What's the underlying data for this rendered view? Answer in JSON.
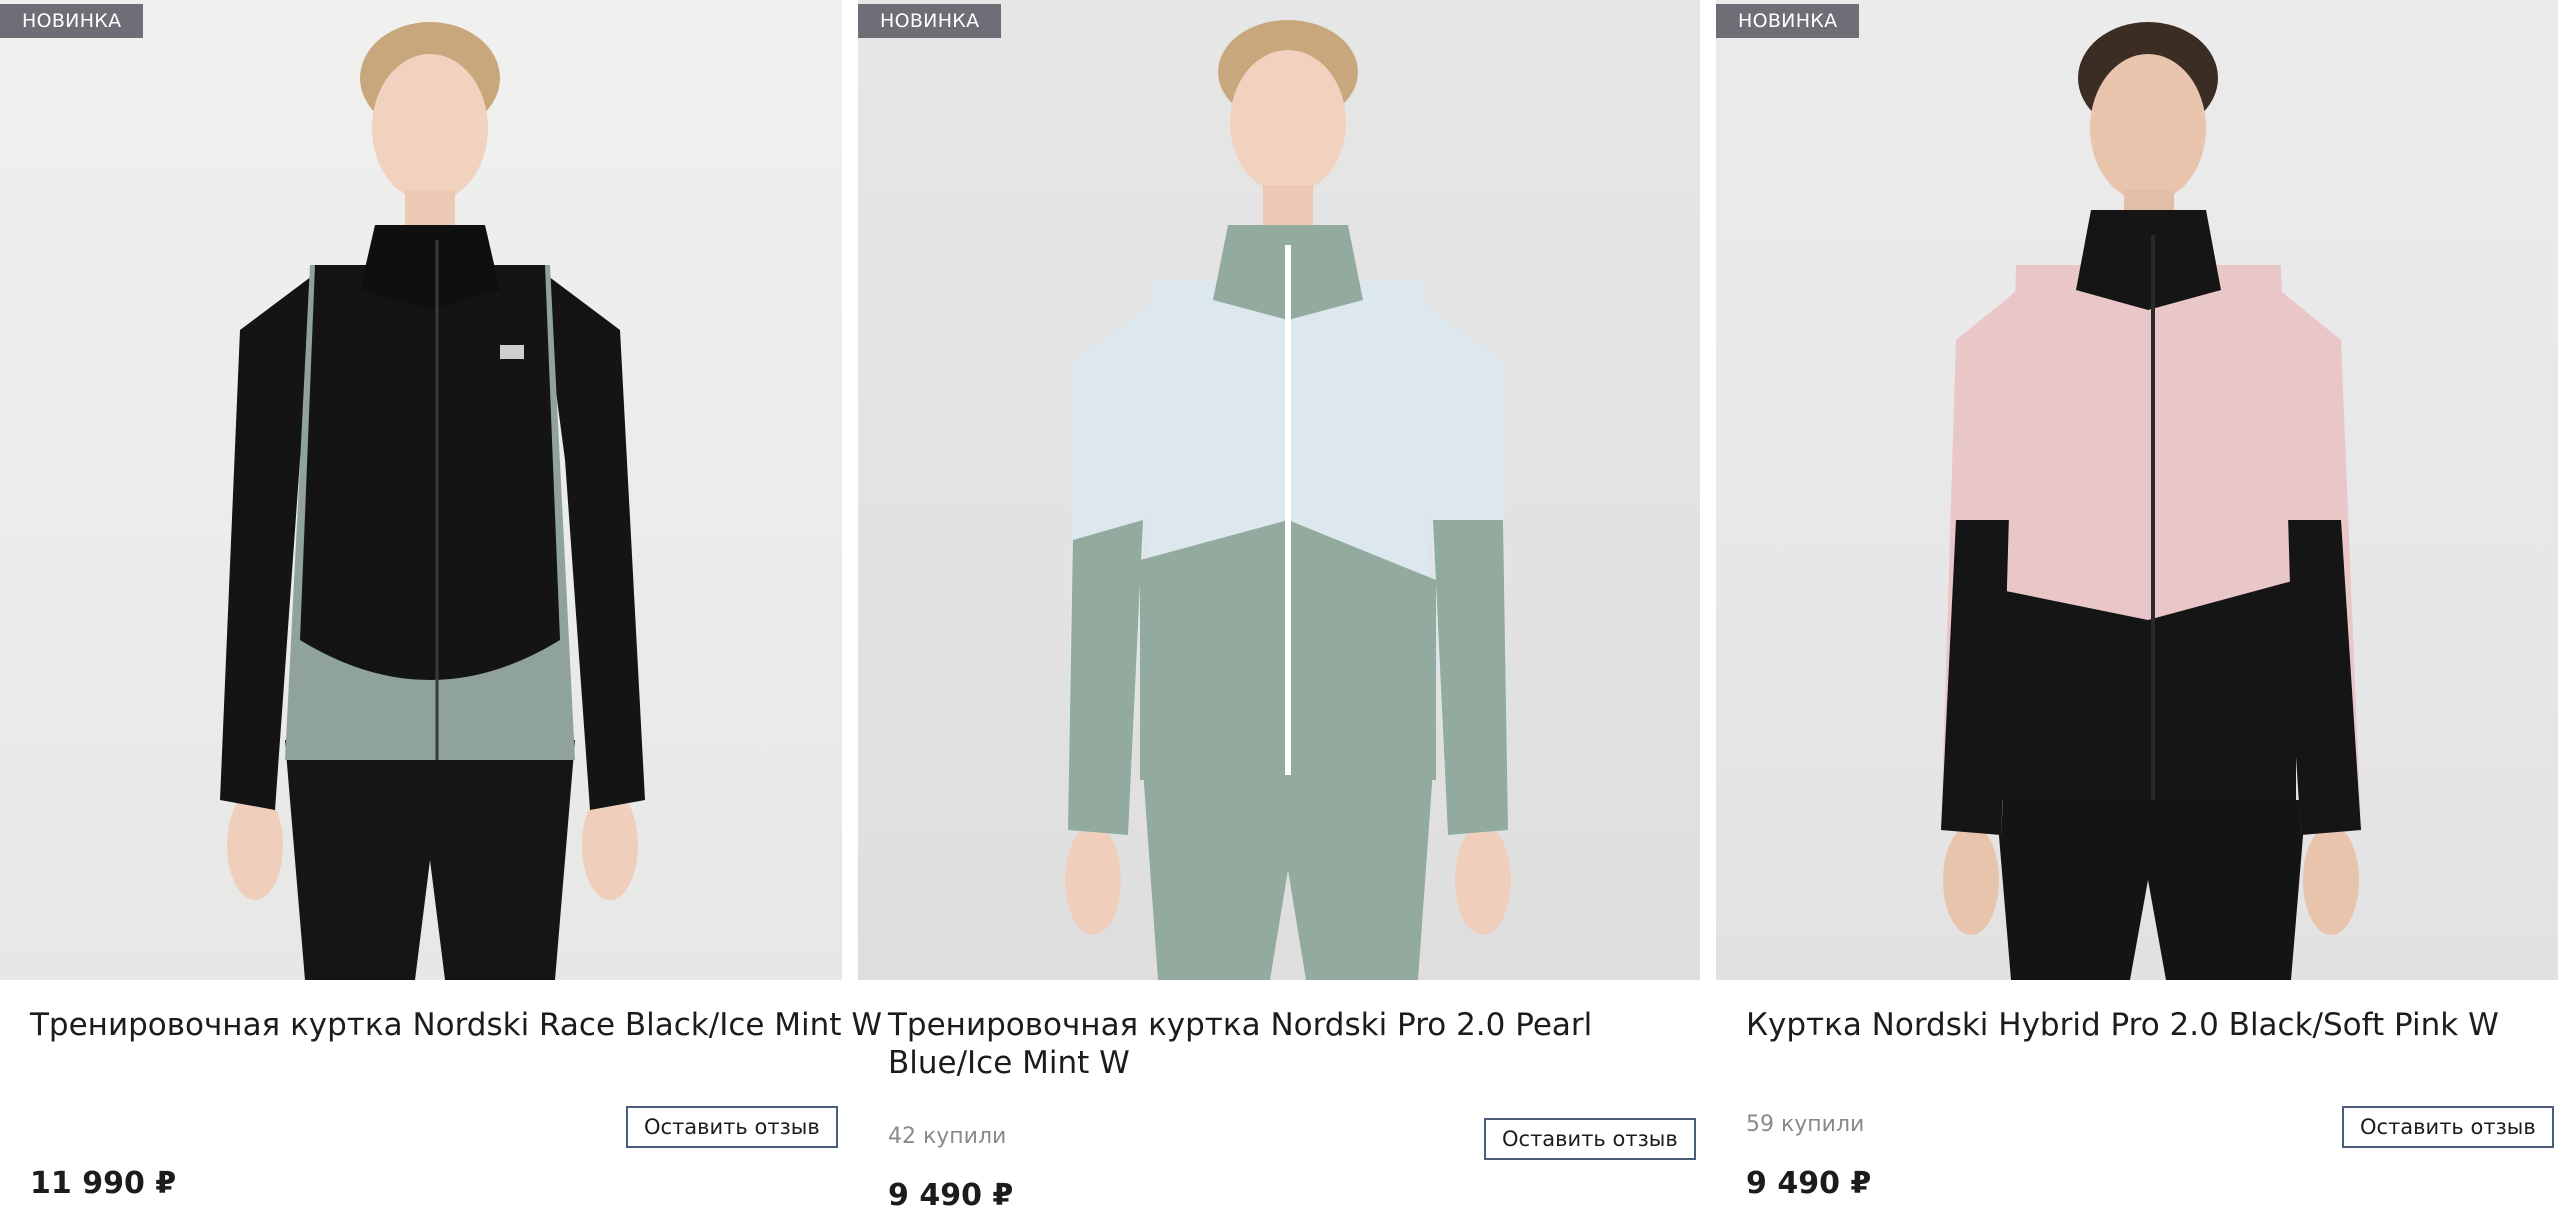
{
  "products": [
    {
      "badge": "НОВИНКА",
      "title": "Тренировочная куртка Nordski Race Black/Ice Mint W",
      "bought": "",
      "review_label": "Оставить отзыв",
      "price": "11 990 ₽",
      "colors": {
        "jacket_main": "#141414",
        "jacket_accent": "#8fa39a",
        "pants": "#151515"
      }
    },
    {
      "badge": "НОВИНКА",
      "title": "Тренировочная куртка Nordski Pro 2.0 Pearl Blue/Ice Mint W",
      "bought": "42 купили",
      "review_label": "Оставить отзыв",
      "price": "9 490 ₽",
      "colors": {
        "jacket_main": "#dde7ee",
        "jacket_accent": "#93ab9f",
        "pants": "#93ab9f"
      }
    },
    {
      "badge": "НОВИНКА",
      "title": "Куртка Nordski Hybrid Pro 2.0 Black/Soft Pink W",
      "bought": "59 купили",
      "review_label": "Оставить отзыв",
      "price": "9 490 ₽",
      "colors": {
        "jacket_main": "#e9c7c8",
        "jacket_accent": "#151515",
        "pants": "#141414"
      }
    }
  ],
  "theme": {
    "badge_bg": "#6e6e77",
    "button_border": "#4a5d7a",
    "muted_text": "#8a8a8a"
  }
}
